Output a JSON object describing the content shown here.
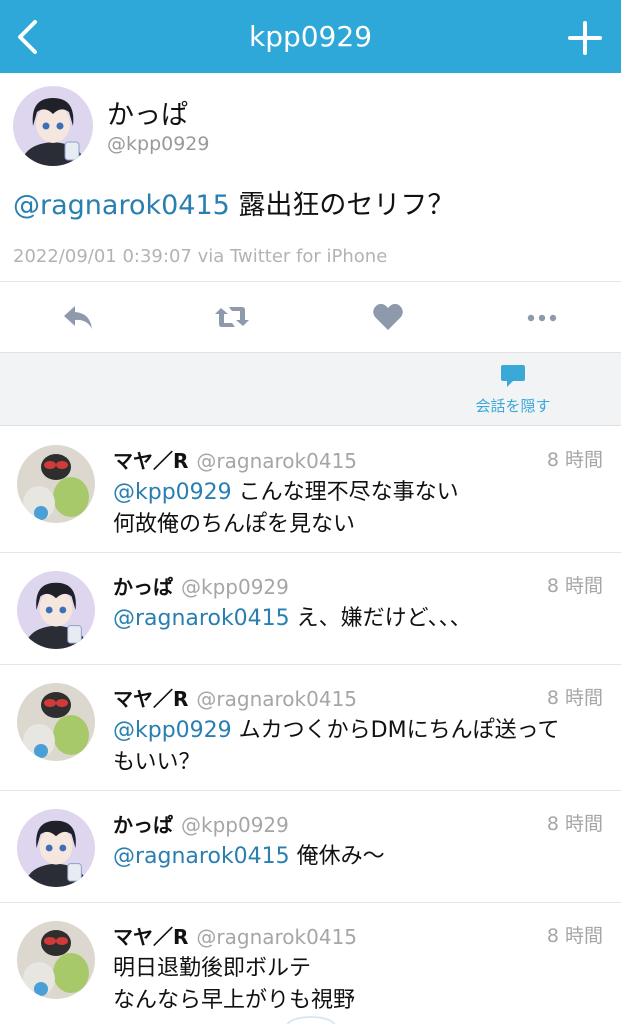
{
  "navbar": {
    "title": "kpp0929",
    "back_icon": "chevron-left-icon",
    "add_icon": "plus-icon",
    "bg_color": "#2ea8d8"
  },
  "main_tweet": {
    "name": "かっぱ",
    "handle": "@kpp0929",
    "mention": "@ragnarok0415",
    "text": " 露出狂のセリフ？",
    "meta": "2022/09/01 0:39:07 via Twitter for iPhone"
  },
  "actions": [
    {
      "icon": "reply-icon"
    },
    {
      "icon": "retweet-icon"
    },
    {
      "icon": "heart-icon"
    },
    {
      "icon": "more-icon"
    }
  ],
  "conversation": {
    "icon": "speech-bubble-icon",
    "label": "会話を隠す"
  },
  "replies": [
    {
      "name": "マヤ／R",
      "handle": "@ragnarok0415",
      "time": "8 時間",
      "mention": "@kpp0929",
      "line1": " こんな理不尽な事ない",
      "line2": "何故俺のちんぽを見ない",
      "avatar": "maya"
    },
    {
      "name": "かっぱ",
      "handle": "@kpp0929",
      "time": "8 時間",
      "mention": "@ragnarok0415",
      "line1": " え、嫌だけど、、、",
      "line2": "",
      "avatar": "kappa"
    },
    {
      "name": "マヤ／R",
      "handle": "@ragnarok0415",
      "time": "8 時間",
      "mention": "@kpp0929",
      "line1": " ムカつくからDMにちんぽ送って",
      "line2": "もいい？",
      "avatar": "maya"
    },
    {
      "name": "かっぱ",
      "handle": "@kpp0929",
      "time": "8 時間",
      "mention": "@ragnarok0415",
      "line1": " 俺休み〜",
      "line2": "",
      "avatar": "kappa"
    },
    {
      "name": "マヤ／R",
      "handle": "@ragnarok0415",
      "time": "8 時間",
      "mention": "",
      "line1": "明日退勤後即ボルテ",
      "line2": "なんなら早上がりも視野",
      "avatar": "maya"
    }
  ]
}
